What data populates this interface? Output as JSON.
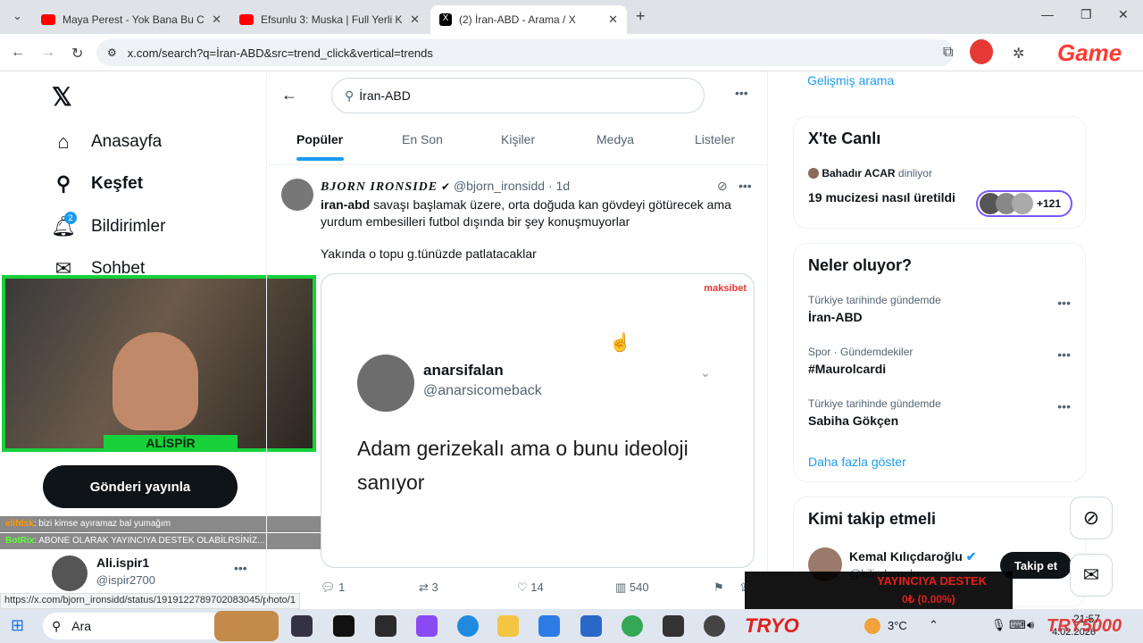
{
  "browser": {
    "tabs": [
      {
        "title": "Maya Perest - Yok Bana Bu Ciha",
        "favicon_color": "#ff0000"
      },
      {
        "title": "Efsunlu 3: Muska | Full Yerli Kor",
        "favicon_color": "#ff0000"
      },
      {
        "title": "(2) İran-ABD - Arama / X",
        "favicon_color": "#000000"
      }
    ],
    "new_tab": "+",
    "url": "x.com/search?q=İran-ABD&src=trend_click&vertical=trends",
    "status_url": "https://x.com/bjorn_ironsidd/status/1919122789702083045/photo/1"
  },
  "x_nav": {
    "items": [
      {
        "label": "Anasayfa",
        "icon": "home-icon"
      },
      {
        "label": "Keşfet",
        "icon": "search-icon"
      },
      {
        "label": "Bildirimler",
        "icon": "bell-icon",
        "badge": "2"
      },
      {
        "label": "Sohbet",
        "icon": "mail-icon"
      }
    ],
    "post_button": "Gönderi yayınla",
    "account_name": "Ali.ispir1",
    "account_handle": "@ispir2700"
  },
  "search": {
    "query": "İran-ABD",
    "tabs": [
      "Popüler",
      "En Son",
      "Kişiler",
      "Medya",
      "Listeler"
    ]
  },
  "tweet": {
    "author": "BJORN IRONSIDE",
    "handle": "@bjorn_ironsidd",
    "time": "1d",
    "text_bold": "iran-abd",
    "text_rest": " savaşı başlamak üzere, orta doğuda kan gövdeyi götürecek ama yurdum embesilleri futbol dışında bir şey konuşmuyorlar",
    "text_second": "Yakında o topu g.tünüzde patlatacaklar",
    "embedded": {
      "brand": "maksibet",
      "name": "anarsifalan",
      "handle": "@anarsicomeback",
      "text": "Adam gerizekalı ama o bunu ideoloji sanıyor"
    },
    "stats": {
      "replies": "1",
      "retweets": "3",
      "likes": "14",
      "views": "540"
    }
  },
  "right": {
    "advanced_search": "Gelişmiş arama",
    "live_title": "X'te Canlı",
    "live_user": "Bahadır ACAR",
    "live_suffix": "dinliyor",
    "live_topic": "19 mucizesi nasıl üretildi",
    "live_count": "+121",
    "trends_title": "Neler oluyor?",
    "trends": [
      {
        "context": "Türkiye tarihinde gündemde",
        "name": "İran-ABD"
      },
      {
        "context": "Spor · Gündemdekiler",
        "name": "#Maurolcardi"
      },
      {
        "context": "Türkiye tarihinde gündemde",
        "name": "Sabiha Gökçen"
      }
    ],
    "show_more": "Daha fazla göster",
    "follow_title": "Kimi takip etmeli",
    "follow_name": "Kemal Kılıçdaroğlu",
    "follow_handle": "@kilicdaroglu",
    "follow_button": "Takip et"
  },
  "stream": {
    "streamer_name": "ALİSPİR",
    "chat": [
      {
        "user": "elifdsk",
        "text": ": bizi kimse ayıramaz bal yumağım"
      },
      {
        "user": "BotRix",
        "text": ": ABONE OLARAK YAYINCIYA DESTEK OLABİLRSİNİZ..."
      }
    ],
    "donation_label": "YAYINCIYA DESTEK",
    "donation_value": "0₺ (0.00%)",
    "overlay_brand": "Game",
    "tryo_left": "TRYO",
    "tryo_right": "TRY5000"
  },
  "taskbar": {
    "search_label": "Ara",
    "weather": "3°C",
    "time": "21:57",
    "date": "4.02.2026"
  }
}
